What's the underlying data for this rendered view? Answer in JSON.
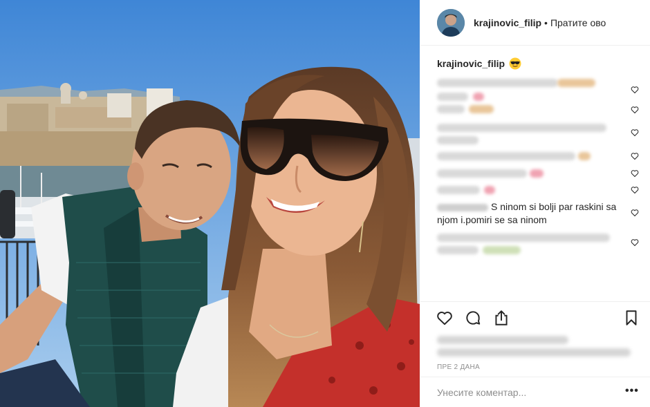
{
  "post": {
    "username": "krajinovic_filip",
    "separator": "•",
    "follow_label": "Пратите ово",
    "caption_emoji": "smiling-face-with-sunglasses",
    "visible_comment": "S ninom si bolji par raskini sa njom i.pomiri se sa ninom",
    "date": "ПРЕ 2 ДАНА",
    "comment_placeholder": "Унесите коментар...",
    "more_label": "•••"
  },
  "icons": {
    "like": "heart-icon",
    "comment": "comment-bubble-icon",
    "share": "share-icon",
    "save": "bookmark-icon",
    "comment_like": "small-heart-icon"
  },
  "colors": {
    "text": "#262626",
    "secondary_text": "#8e8e8e",
    "divider": "#efefef",
    "sky": "#6aa3d8"
  }
}
